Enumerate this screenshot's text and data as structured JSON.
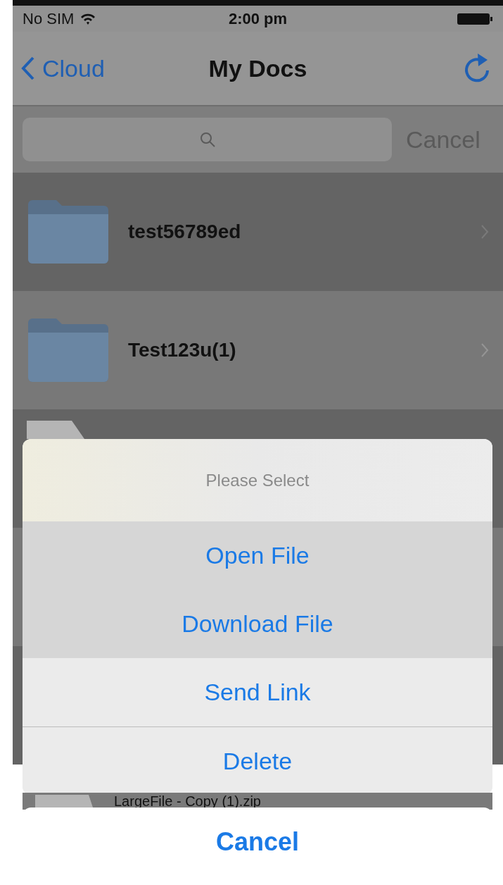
{
  "status_bar": {
    "carrier": "No SIM",
    "time": "2:00 pm"
  },
  "nav_bar": {
    "back": "Cloud",
    "title": "My Docs"
  },
  "search": {
    "cancel": "Cancel"
  },
  "items": [
    {
      "kind": "folder",
      "name": "test56789ed"
    },
    {
      "kind": "folder",
      "name": "Test123u(1)"
    },
    {
      "kind": "file"
    },
    {
      "kind": "blank"
    },
    {
      "kind": "blank"
    },
    {
      "kind": "file",
      "name": "LargeFile - Copy (1).zip"
    }
  ],
  "action_sheet": {
    "title": "Please Select",
    "options": [
      {
        "label": "Open File",
        "highlighted": true
      },
      {
        "label": "Download File",
        "highlighted": true
      },
      {
        "label": "Send Link",
        "highlighted": false
      },
      {
        "label": "Delete",
        "highlighted": false
      }
    ],
    "cancel": "Cancel"
  }
}
